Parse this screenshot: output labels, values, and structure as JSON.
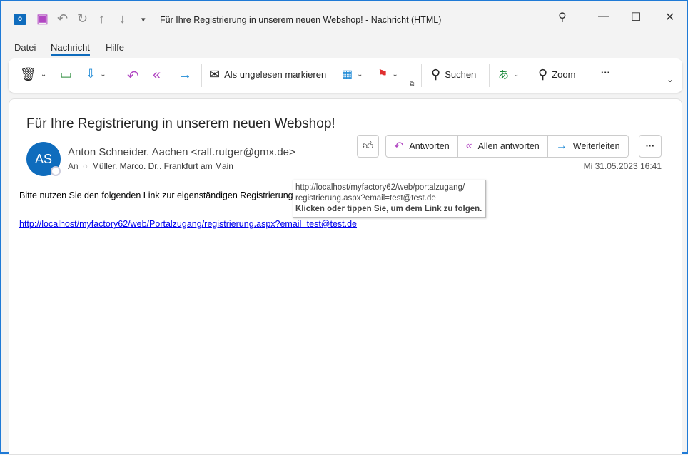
{
  "window": {
    "title": "Für Ihre Registrierung in unserem neuen Webshop!  -  Nachricht (HTML)"
  },
  "menu": [
    "Datei",
    "Nachricht",
    "Hilfe"
  ],
  "ribbon": {
    "mark_unread": "Als ungelesen markieren",
    "search": "Suchen",
    "zoom": "Zoom"
  },
  "message": {
    "subject": "Für Ihre Registrierung in unserem neuen Webshop!",
    "avatar_initials": "AS",
    "from": "Anton Schneider. Aachen <ralf.rutger@gmx.de>",
    "to_label": "An",
    "to": "Müller. Marco. Dr.. Frankfurt am Main",
    "date": "Mi 31.05.2023 16:41",
    "reply": "Antworten",
    "reply_all": "Allen antworten",
    "forward": "Weiterleiten",
    "body_text": "Bitte nutzen Sie den folgenden Link zur eigenständigen Registrierung:",
    "link": "http://localhost/myfactory62/web/Portalzugang/registrierung.aspx?email=test@test.de"
  },
  "tooltip": {
    "line1": "http://localhost/myfactory62/web/portalzugang/",
    "line2": "registrierung.aspx?email=test@test.de",
    "hint": "Klicken oder tippen Sie, um dem Link zu folgen."
  },
  "colors": {
    "accent": "#0f6cbd",
    "reply": "#b146c2",
    "forward": "#1f8ad6"
  }
}
